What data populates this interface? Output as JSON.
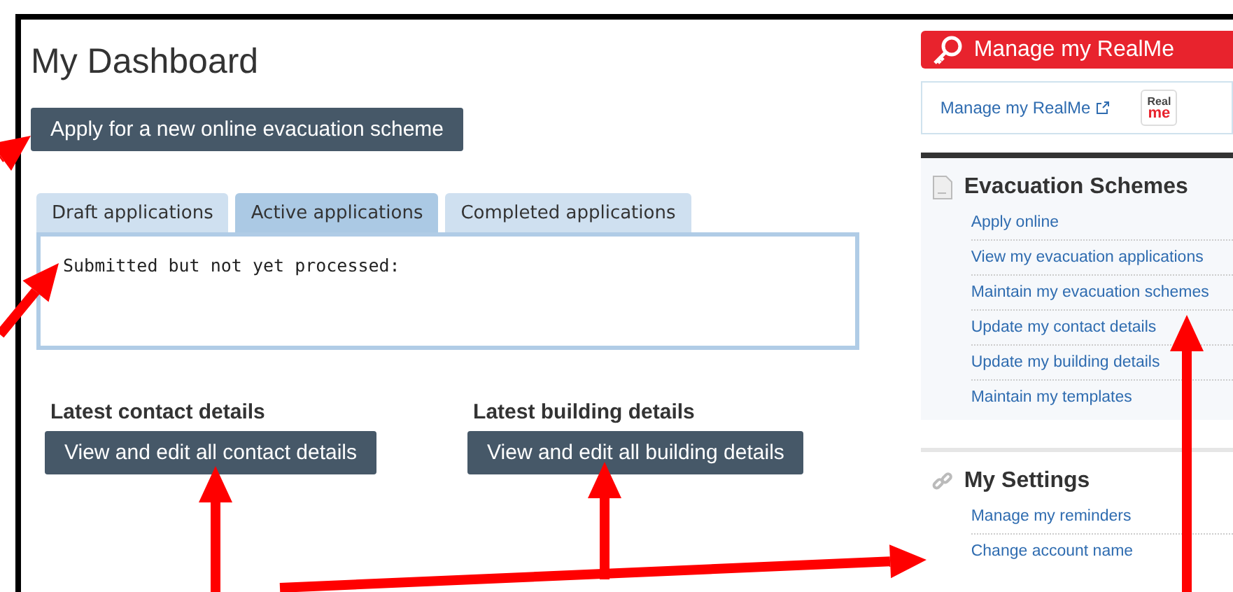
{
  "page": {
    "title": "My Dashboard"
  },
  "apply_button": "Apply for a new online evacuation scheme",
  "tabs": [
    {
      "label": "Draft applications",
      "selected": false
    },
    {
      "label": "Active applications",
      "selected": true
    },
    {
      "label": "Completed applications",
      "selected": false
    }
  ],
  "tab_panel": {
    "text": "Submitted but not yet processed:"
  },
  "details": [
    {
      "heading": "Latest contact details",
      "button": "View and edit all contact details"
    },
    {
      "heading": "Latest building details",
      "button": "View and edit all building details"
    }
  ],
  "sidebar": {
    "realme_button": "Manage my RealMe",
    "realme_link": "Manage my RealMe",
    "realme_logo": {
      "top": "Real",
      "bottom": "me"
    },
    "sections": [
      {
        "kind": "document",
        "title": "Evacuation Schemes",
        "links": [
          "Apply online",
          "View my evacuation applications",
          "Maintain my evacuation schemes",
          "Update my contact details",
          "Update my building details",
          "Maintain my templates"
        ]
      },
      {
        "kind": "chain",
        "title": "My Settings",
        "links": [
          "Manage my reminders",
          "Change account name"
        ]
      }
    ]
  }
}
